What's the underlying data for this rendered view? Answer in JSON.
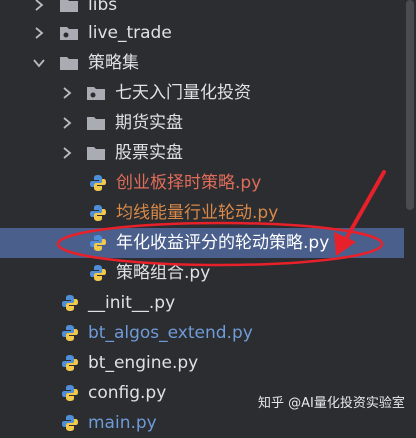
{
  "tree": {
    "items": [
      {
        "label": "libs"
      },
      {
        "label": "live_trade"
      },
      {
        "label": "策略集"
      },
      {
        "label": "七天入门量化投资"
      },
      {
        "label": "期货实盘"
      },
      {
        "label": "股票实盘"
      },
      {
        "label": "创业板择时策略.py"
      },
      {
        "label": "均线能量行业轮动.py"
      },
      {
        "label": "年化收益评分的轮动策略.py"
      },
      {
        "label": "策略组合.py"
      },
      {
        "label": "__init__.py"
      },
      {
        "label": "bt_algos_extend.py"
      },
      {
        "label": "bt_engine.py"
      },
      {
        "label": "config.py"
      },
      {
        "label": "main.py"
      }
    ]
  },
  "watermark": {
    "text": "知乎 @AI量化投资实验室"
  },
  "colors": {
    "background": "#2b2d30",
    "selection": "#4a5f8c",
    "modified_red": "#e06c5a",
    "modified_orange": "#d9894a",
    "vcs_blue": "#6f9bd8",
    "annotation_red": "#e8202a"
  }
}
